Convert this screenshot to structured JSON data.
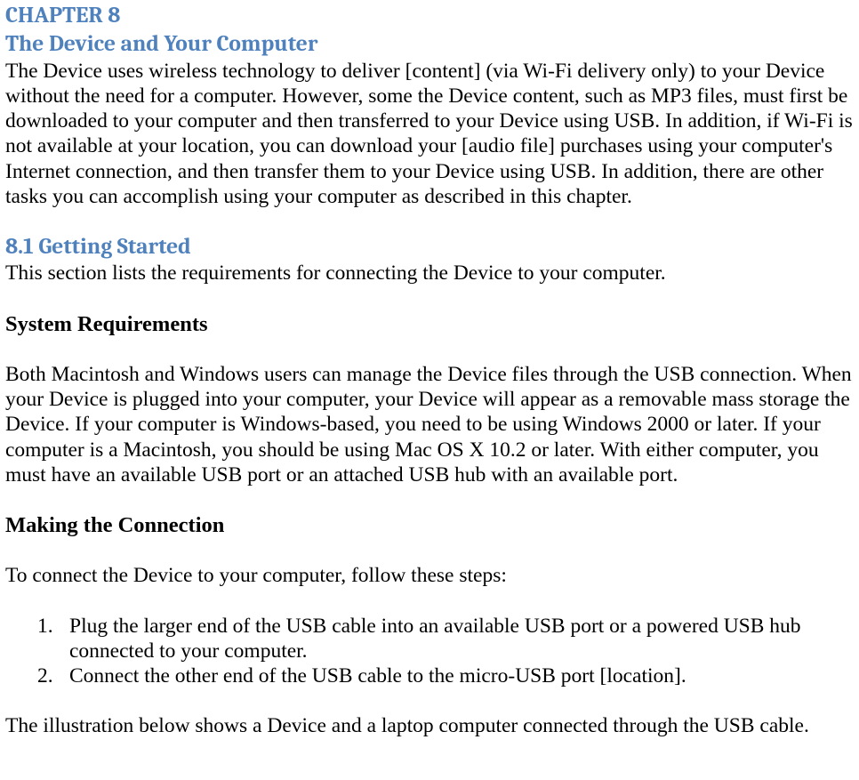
{
  "chapter": {
    "label": "CHAPTER 8",
    "title": "The Device and Your Computer",
    "intro": "The Device uses wireless technology to deliver [content] (via Wi-Fi delivery only) to your Device without the need for a computer. However, some the Device content, such as MP3 files, must first be downloaded to your computer and then transferred to your Device using USB. In addition, if Wi-Fi is not available at your location, you can download your [audio file] purchases using your computer's Internet connection, and then transfer them to your Device using USB. In addition, there are other tasks you can accomplish using your computer as described in this chapter."
  },
  "section_8_1": {
    "heading": "8.1 Getting Started",
    "intro": "This section lists the requirements for connecting the Device to your computer."
  },
  "system_requirements": {
    "heading": "System Requirements",
    "body": "Both Macintosh and Windows users can manage the Device files through the USB connection. When your Device is plugged into your computer, your Device will appear as a removable mass storage the Device. If your computer is Windows-based, you need to be using Windows 2000 or later. If your computer is a Macintosh, you should be using Mac OS X 10.2 or later. With either computer, you must have an available USB port or an attached USB hub with an available port."
  },
  "making_connection": {
    "heading": "Making the Connection",
    "intro": "To connect the Device to your computer, follow these steps:",
    "steps": [
      "Plug the larger end of the USB cable into an available USB port or a powered USB hub connected to your computer.",
      "Connect the other end of the USB cable to the micro-USB port [location]."
    ],
    "outro": "The illustration below shows a Device and a laptop computer connected through the USB cable."
  }
}
